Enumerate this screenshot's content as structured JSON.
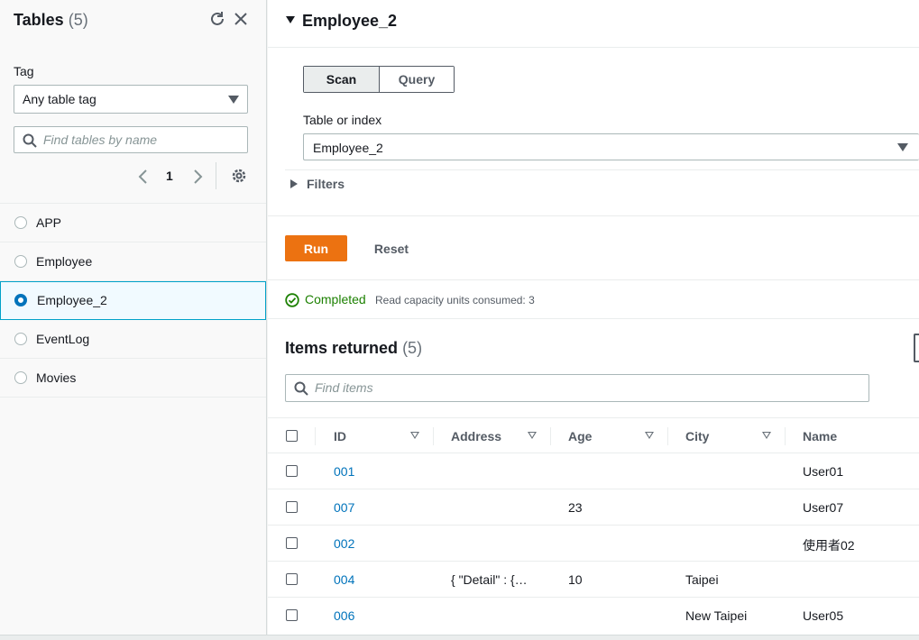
{
  "left_panel": {
    "title": "Tables",
    "count": "(5)",
    "tag_label": "Tag",
    "tag_select_value": "Any table tag",
    "search_placeholder": "Find tables by name",
    "page": "1",
    "tables": [
      {
        "name": "APP",
        "selected": false
      },
      {
        "name": "Employee",
        "selected": false
      },
      {
        "name": "Employee_2",
        "selected": true
      },
      {
        "name": "EventLog",
        "selected": false
      },
      {
        "name": "Movies",
        "selected": false
      }
    ]
  },
  "main": {
    "title": "Employee_2",
    "modes": [
      "Scan",
      "Query"
    ],
    "active_mode": "Scan",
    "table_or_index_label": "Table or index",
    "table_or_index_value": "Employee_2",
    "filters_label": "Filters",
    "run_label": "Run",
    "reset_label": "Reset",
    "status_text": "Completed",
    "status_detail": "Read capacity units consumed: 3",
    "items_title": "Items returned",
    "items_count": "(5)",
    "items_search_placeholder": "Find items",
    "columns": [
      "ID",
      "Address",
      "Age",
      "City",
      "Name"
    ],
    "rows": [
      {
        "ID": "001",
        "Address": "",
        "Age": "",
        "City": "",
        "Name": "User01"
      },
      {
        "ID": "007",
        "Address": "",
        "Age": "23",
        "City": "",
        "Name": "User07"
      },
      {
        "ID": "002",
        "Address": "",
        "Age": "",
        "City": "",
        "Name": "使用者02"
      },
      {
        "ID": "004",
        "Address": "{ \"Detail\" : {…",
        "Age": "10",
        "City": "Taipei",
        "Name": ""
      },
      {
        "ID": "006",
        "Address": "",
        "Age": "",
        "City": "New Taipei",
        "Name": "User05"
      }
    ]
  },
  "colors": {
    "accent_orange": "#ec7211",
    "link_blue": "#0073bb",
    "success_green": "#1d8102"
  },
  "icons": [
    "refresh-icon",
    "close-icon",
    "search-icon",
    "chevron-left-icon",
    "chevron-right-icon",
    "gear-icon",
    "check-circle-icon",
    "sort-icon"
  ]
}
